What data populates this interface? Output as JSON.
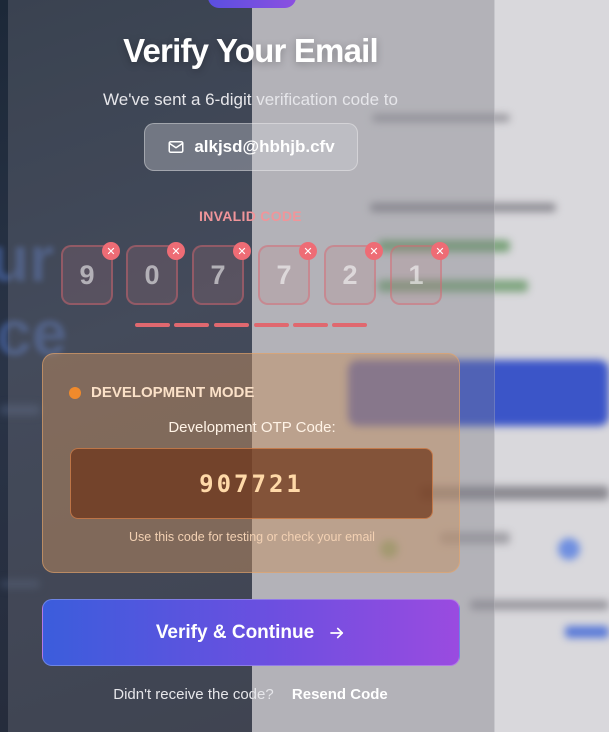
{
  "header": {
    "title": "Verify Your Email",
    "subtitle": "We've sent a 6-digit verification code to",
    "email": "alkjsd@hbhjb.cfv",
    "email_icon": "mail-icon"
  },
  "otp": {
    "status": "INVALID CODE",
    "digits": [
      "9",
      "0",
      "7",
      "7",
      "2",
      "1"
    ],
    "clear_icon": "close-icon",
    "error_color": "#ee6c75"
  },
  "dev_panel": {
    "badge": "DEVELOPMENT MODE",
    "label": "Development OTP Code:",
    "code": "907721",
    "hint": "Use this code for testing or check your email",
    "accent_color": "#f08a2c"
  },
  "actions": {
    "verify_label": "Verify & Continue",
    "verify_icon": "arrow-right-icon",
    "resend_prompt": "Didn't receive the code?",
    "resend_label": "Resend Code"
  }
}
